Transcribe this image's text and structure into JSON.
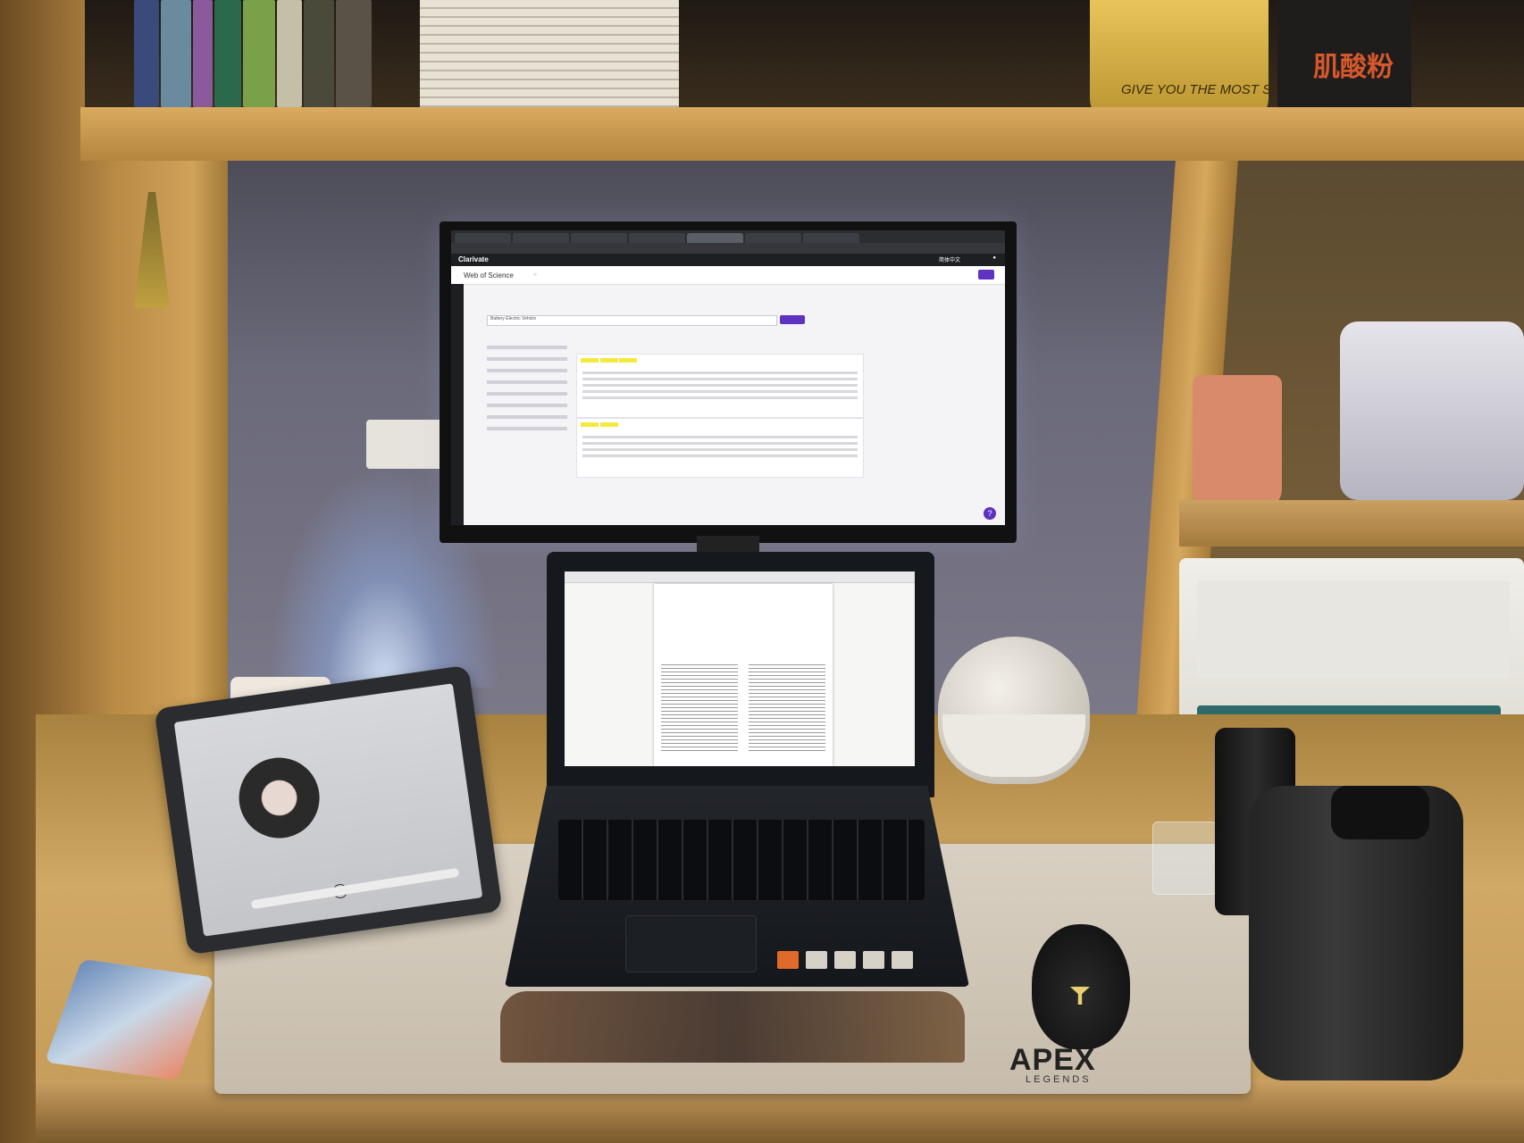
{
  "monitor": {
    "tabs": [
      "",
      "",
      "",
      "",
      "",
      "",
      ""
    ],
    "brand": "Clarivate",
    "site": "Web of Science",
    "language": "简体中文",
    "results_title": "Battery Electric Vehicle"
  },
  "laptop": {
    "paper_title": "",
    "zoom": ""
  },
  "tablet": {
    "song_title": "",
    "song_artist": ""
  },
  "tin": {
    "text": "GIVE YOU THE MOST SPECIAL"
  },
  "supplement": {
    "label": "肌酸粉"
  },
  "mousepad": {
    "brand": "APEX",
    "sub": "LEGENDS"
  },
  "colors": {
    "wos_accent": "#5e33bf",
    "highlight": "#f3ea40",
    "desk": "#c39a57"
  }
}
